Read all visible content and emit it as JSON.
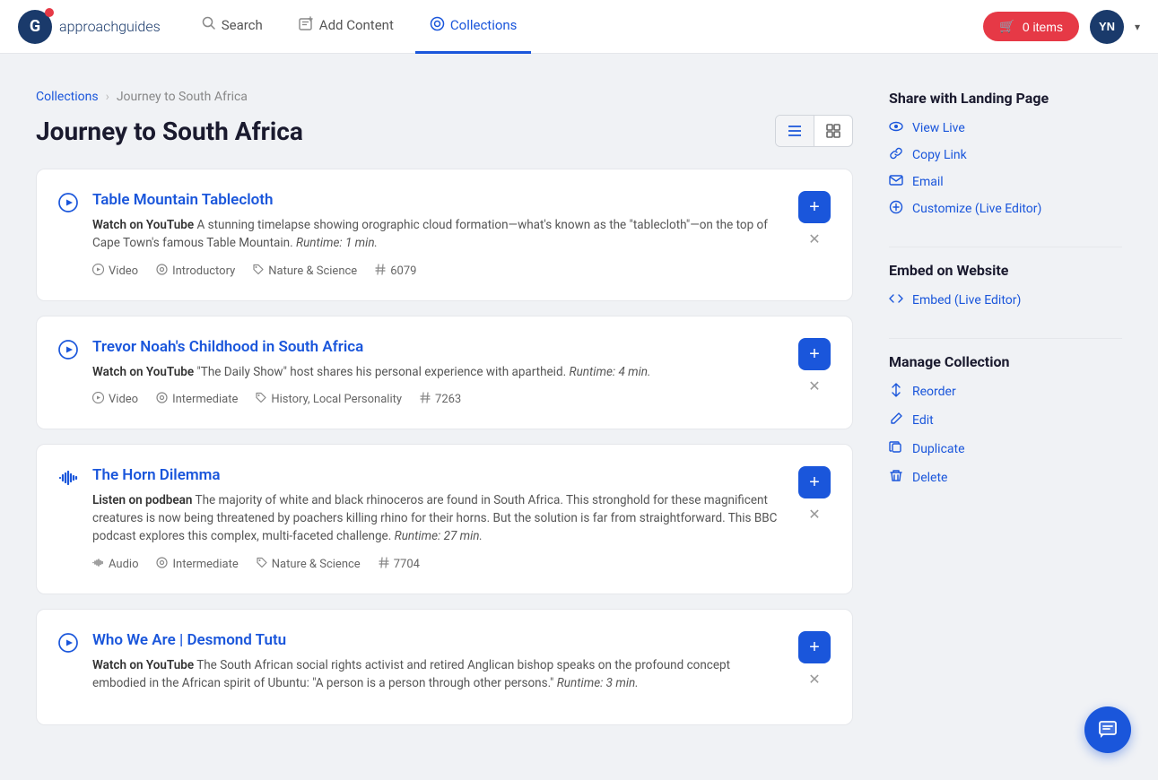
{
  "header": {
    "logo_letter": "G",
    "logo_text_bold": "approach",
    "logo_text_light": "guides",
    "nav": [
      {
        "id": "search",
        "label": "Search",
        "icon": "🔍",
        "active": false
      },
      {
        "id": "add-content",
        "label": "Add Content",
        "icon": "📋",
        "active": false
      },
      {
        "id": "collections",
        "label": "Collections",
        "icon": "⊙",
        "active": true
      }
    ],
    "cart_label": "0 items",
    "avatar_initials": "YN"
  },
  "breadcrumb": {
    "parent": "Collections",
    "separator": "›",
    "current": "Journey to South Africa"
  },
  "page": {
    "title": "Journey to South Africa"
  },
  "view_toggle": {
    "list_label": "≡",
    "grid_label": "⊞"
  },
  "content_items": [
    {
      "id": "item-1",
      "icon": "▶",
      "icon_type": "video",
      "title": "Table Mountain Tablecloth",
      "watch_label": "Watch on YouTube",
      "description": "A stunning timelapse showing orographic cloud formation—what's known as the \"tablecloth\"—on the top of Cape Town's famous Table Mountain.",
      "runtime": "Runtime: 1 min.",
      "tags": [
        {
          "icon": "▶",
          "label": "Video"
        },
        {
          "icon": "◎",
          "label": "Introductory"
        },
        {
          "icon": "⚑",
          "label": "Nature & Science"
        },
        {
          "icon": "#",
          "label": "6079"
        }
      ]
    },
    {
      "id": "item-2",
      "icon": "▶",
      "icon_type": "video",
      "title": "Trevor Noah's Childhood in South Africa",
      "watch_label": "Watch on YouTube",
      "description": "\"The Daily Show\" host shares his personal experience with apartheid.",
      "runtime": "Runtime: 4 min.",
      "tags": [
        {
          "icon": "▶",
          "label": "Video"
        },
        {
          "icon": "◎",
          "label": "Intermediate"
        },
        {
          "icon": "⚑",
          "label": "History, Local Personality"
        },
        {
          "icon": "#",
          "label": "7263"
        }
      ]
    },
    {
      "id": "item-3",
      "icon": "🎵",
      "icon_type": "audio",
      "title": "The Horn Dilemma",
      "watch_label": "Listen on podbean",
      "description": "The majority of white and black rhinoceros are found in South Africa. This stronghold for these magnificent creatures is now being threatened by poachers killing rhino for their horns. But the solution is far from straightforward. This BBC podcast explores this complex, multi-faceted challenge.",
      "runtime": "Runtime: 27 min.",
      "tags": [
        {
          "icon": "🎵",
          "label": "Audio"
        },
        {
          "icon": "◎",
          "label": "Intermediate"
        },
        {
          "icon": "⚑",
          "label": "Nature & Science"
        },
        {
          "icon": "#",
          "label": "7704"
        }
      ]
    },
    {
      "id": "item-4",
      "icon": "▶",
      "icon_type": "video",
      "title": "Who We Are | Desmond Tutu",
      "watch_label": "Watch on YouTube",
      "description": "The South African social rights activist and retired Anglican bishop speaks on the profound concept embodied in the African spirit of Ubuntu: \"A person is a person through other persons.\"",
      "runtime": "Runtime: 3 min.",
      "tags": []
    }
  ],
  "sidebar": {
    "share_heading": "Share with Landing Page",
    "share_links": [
      {
        "icon": "👁",
        "label": "View Live"
      },
      {
        "icon": "🔗",
        "label": "Copy Link"
      },
      {
        "icon": "✉",
        "label": "Email"
      },
      {
        "icon": "⚙",
        "label": "Customize (Live Editor)"
      }
    ],
    "embed_heading": "Embed on Website",
    "embed_links": [
      {
        "icon": "</>",
        "label": "Embed (Live Editor)"
      }
    ],
    "manage_heading": "Manage Collection",
    "manage_links": [
      {
        "icon": "↕",
        "label": "Reorder"
      },
      {
        "icon": "✏",
        "label": "Edit"
      },
      {
        "icon": "⧉",
        "label": "Duplicate"
      },
      {
        "icon": "🗑",
        "label": "Delete"
      }
    ]
  }
}
